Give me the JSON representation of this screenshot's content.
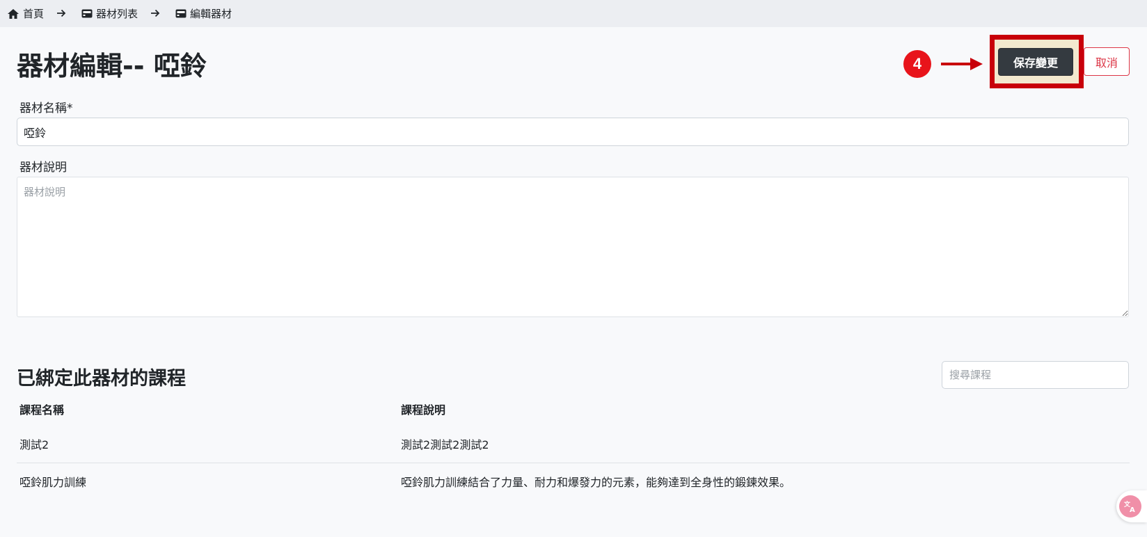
{
  "breadcrumb": {
    "home": "首頁",
    "list": "器材列表",
    "current": "編輯器材"
  },
  "page_title": "器材編輯-- 啞鈴",
  "annotation": {
    "step_number": "4"
  },
  "actions": {
    "save_label": "保存變更",
    "cancel_label": "取消"
  },
  "form": {
    "name_label": "器材名稱*",
    "name_value": "啞鈴",
    "desc_label": "器材說明",
    "desc_value": "",
    "desc_placeholder": "器材說明"
  },
  "courses": {
    "title": "已綁定此器材的課程",
    "search_placeholder": "搜尋課程",
    "columns": [
      "課程名稱",
      "課程說明"
    ],
    "rows": [
      {
        "name": "測試2",
        "description": "測試2測試2測試2"
      },
      {
        "name": "啞鈴肌力訓練",
        "description": "啞鈴肌力訓練結合了力量、耐力和爆發力的元素，能夠達到全身性的鍛鍊效果。"
      }
    ]
  },
  "icons": {
    "home": "home-icon",
    "arrow": "arrow-right-icon",
    "equipment": "equipment-icon",
    "translate": "translate-icon"
  },
  "colors": {
    "save_bg": "#343a40",
    "cancel": "#dc3545",
    "highlight": "#c8000a",
    "badge": "#e8141b"
  }
}
